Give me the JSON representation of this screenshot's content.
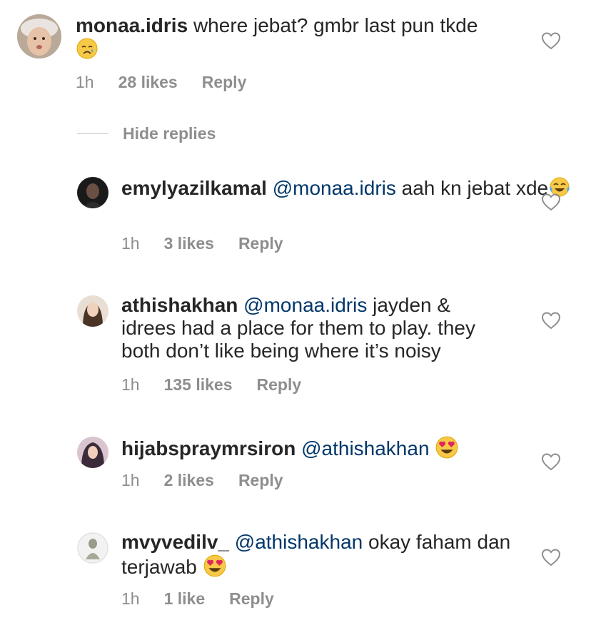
{
  "comments": [
    {
      "username": "monaa.idris",
      "mention": "",
      "text": "where jebat? gmbr last pun tkde",
      "emoji": "crying-face",
      "time": "1h",
      "likes": "28 likes",
      "reply_label": "Reply"
    },
    {
      "username": "emylyazilkamal",
      "mention": "@monaa.idris",
      "text": "aah kn jebat xde",
      "emoji": "tears-of-joy",
      "time": "1h",
      "likes": "3 likes",
      "reply_label": "Reply"
    },
    {
      "username": "athishakhan",
      "mention": "@monaa.idris",
      "text_line1": "jayden &",
      "text_line2": "idrees had a place for them to play. they",
      "text_line3": "both don’t like being where it’s noisy",
      "time": "1h",
      "likes": "135 likes",
      "reply_label": "Reply"
    },
    {
      "username": "hijabspraymrsiron",
      "mention": "@athishakhan",
      "text": "",
      "emoji": "heart-eyes",
      "time": "1h",
      "likes": "2 likes",
      "reply_label": "Reply"
    },
    {
      "username": "mvyvedilv_",
      "mention": "@athishakhan",
      "text_line1": "okay faham dan",
      "text_line2": "terjawab",
      "emoji": "heart-eyes",
      "time": "1h",
      "likes": "1 like",
      "reply_label": "Reply"
    }
  ],
  "hide_replies_label": "Hide replies",
  "icons": {
    "like": "heart-outline-icon"
  }
}
